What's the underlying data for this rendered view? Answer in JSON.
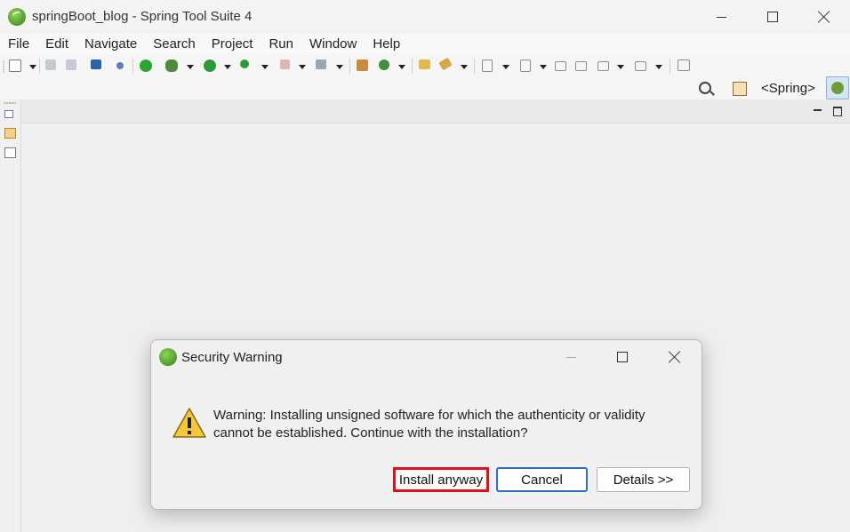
{
  "window": {
    "title": "springBoot_blog - Spring Tool Suite 4"
  },
  "menu": {
    "items": [
      "File",
      "Edit",
      "Navigate",
      "Search",
      "Project",
      "Run",
      "Window",
      "Help"
    ]
  },
  "perspective": {
    "label": "<Spring>"
  },
  "dialog": {
    "title": "Security Warning",
    "message_line1": "Warning: Installing unsigned software for which the authenticity or validity",
    "message_line2": "cannot be established. Continue with the installation?",
    "buttons": {
      "install": "Install anyway",
      "cancel": "Cancel",
      "details": "Details >>"
    }
  },
  "colors": {
    "highlight_border": "#e0101a",
    "default_button_border": "#2f6cc2",
    "spring_green": "#6db33f"
  }
}
